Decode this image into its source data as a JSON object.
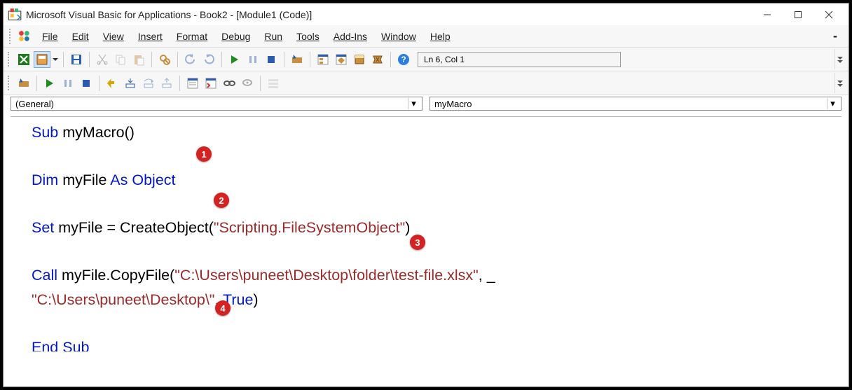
{
  "title": "Microsoft Visual Basic for Applications - Book2 - [Module1 (Code)]",
  "menu": {
    "file": "File",
    "edit": "Edit",
    "view": "View",
    "insert": "Insert",
    "format": "Format",
    "debug": "Debug",
    "run": "Run",
    "tools": "Tools",
    "addins": "Add-Ins",
    "window": "Window",
    "help": "Help"
  },
  "status": {
    "cursor": "Ln 6, Col 1"
  },
  "dropdowns": {
    "left": "(General)",
    "right": "myMacro"
  },
  "code": {
    "l1_sub": "Sub",
    "l1_rest": " myMacro()",
    "l3_dim": "Dim",
    "l3_mid": " myFile ",
    "l3_as": "As",
    "l3_sp": " ",
    "l3_obj": "Object",
    "l5_set": "Set",
    "l5_mid": " myFile = CreateObject(",
    "l5_str": "\"Scripting.FileSystemObject\"",
    "l5_end": ")",
    "l7_call": "Call",
    "l7_mid": " myFile.CopyFile(",
    "l7_str": "\"C:\\Users\\puneet\\Desktop\\folder\\test-file.xlsx\"",
    "l7_end": ", _",
    "l8_str": "\"C:\\Users\\puneet\\Desktop\\\"",
    "l8_mid": ", ",
    "l8_true": "True",
    "l8_end": ")",
    "l10_end": "End Sub"
  },
  "badges": {
    "b1": "1",
    "b2": "2",
    "b3": "3",
    "b4": "4"
  }
}
